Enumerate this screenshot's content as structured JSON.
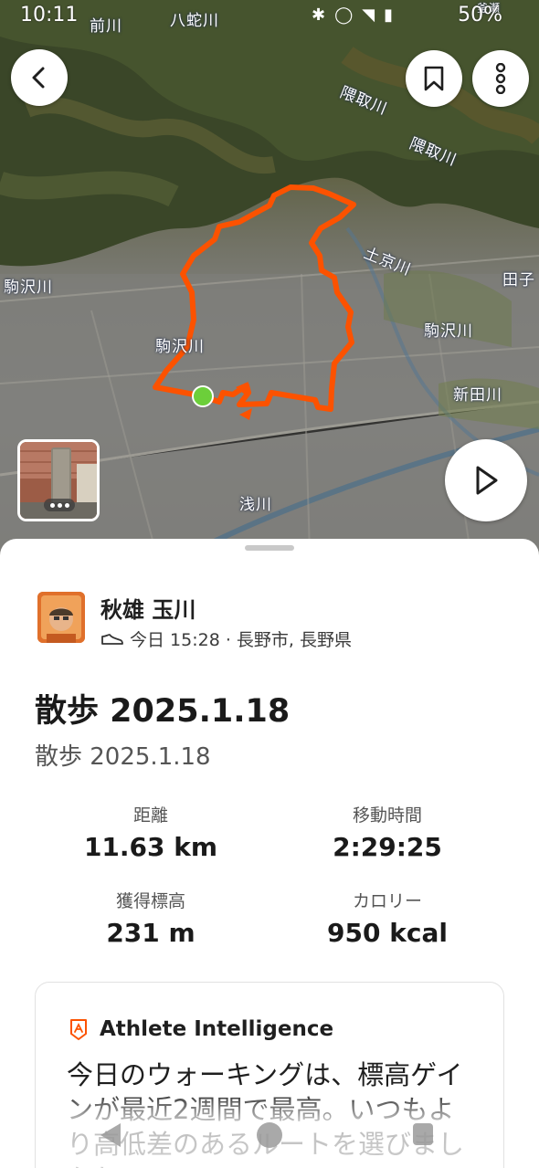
{
  "status_bar": {
    "time": "10:11",
    "battery": "50%",
    "icons": [
      "bluetooth-icon",
      "alarm-icon",
      "wifi-icon",
      "signal-icon",
      "battery-icon"
    ]
  },
  "map": {
    "labels": [
      {
        "text": "隈取川"
      },
      {
        "text": "隈取川"
      },
      {
        "text": "土京川"
      },
      {
        "text": "駒沢川"
      },
      {
        "text": "駒沢川"
      },
      {
        "text": "駒沢川"
      },
      {
        "text": "新田川"
      },
      {
        "text": "浅川"
      },
      {
        "text": "田子"
      },
      {
        "text": "八蛇川"
      },
      {
        "text": "前川"
      },
      {
        "text": "釜瀬"
      }
    ],
    "route_color": "#fc5200",
    "start_color": "#6ccf3a"
  },
  "buttons": {
    "back": "chevron-left-icon",
    "bookmark": "bookmark-icon",
    "more": "more-vertical-icon",
    "play": "play-icon"
  },
  "athlete": {
    "name": "秋雄 玉川",
    "meta": "今日 15:28 · 長野市, 長野県"
  },
  "activity": {
    "title": "散歩 2025.1.18",
    "description": "散歩 2025.1.18"
  },
  "stats": {
    "distance": {
      "label": "距離",
      "value": "11.63 km"
    },
    "moving_time": {
      "label": "移動時間",
      "value": "2:29:25"
    },
    "elevation": {
      "label": "獲得標高",
      "value": "231 m"
    },
    "calories": {
      "label": "カロリー",
      "value": "950 kcal"
    }
  },
  "athlete_intelligence": {
    "title": "Athlete Intelligence",
    "body": "今日のウォーキングは、標高ゲインが最近2週間で最高。いつもより高低差のあるルートを選びましたね。"
  },
  "colors": {
    "accent": "#fc5200",
    "text": "#1f1f1f",
    "muted": "#555555"
  }
}
